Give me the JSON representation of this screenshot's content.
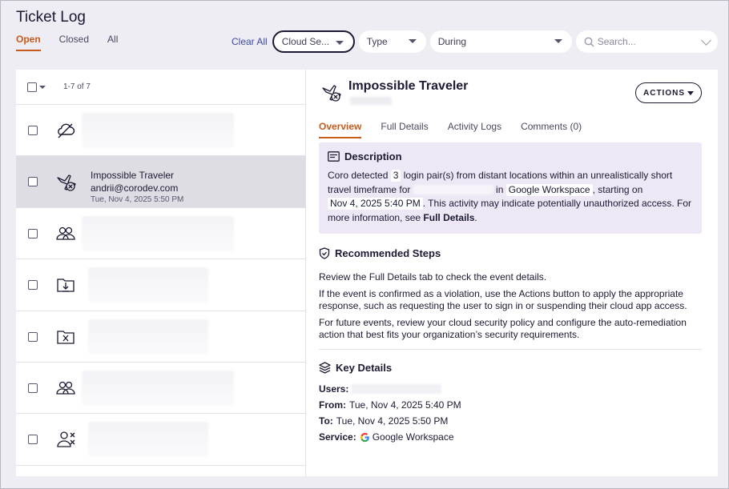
{
  "page_title": "Ticket Log",
  "tabs": [
    {
      "label": "Open",
      "active": true
    },
    {
      "label": "Closed",
      "active": false
    },
    {
      "label": "All",
      "active": false
    }
  ],
  "filters": {
    "clear_all": "Clear All",
    "cloud_service": "Cloud Se...",
    "type": "Type",
    "during": "During",
    "search_placeholder": "Search..."
  },
  "list": {
    "count_label": "1-7 of 7",
    "rows": [
      {
        "icon": "cloud-icon",
        "title": "",
        "subtitle": "",
        "date": "",
        "selected": false
      },
      {
        "icon": "impossible-traveler-icon",
        "title": "Impossible Traveler",
        "subtitle": "andrii@corodev.com",
        "date": "Tue, Nov 4, 2025 5:50 PM",
        "selected": true
      },
      {
        "icon": "users-icon",
        "title": "",
        "subtitle": "",
        "date": "",
        "selected": false
      },
      {
        "icon": "download-folder-icon",
        "title": "",
        "subtitle": "",
        "date": "",
        "selected": false
      },
      {
        "icon": "folder-x-icon",
        "title": "",
        "subtitle": "",
        "date": "",
        "selected": false
      },
      {
        "icon": "users-icon",
        "title": "",
        "subtitle": "",
        "date": "",
        "selected": false
      },
      {
        "icon": "user-x-icon",
        "title": "",
        "subtitle": "",
        "date": "",
        "selected": false
      }
    ]
  },
  "detail": {
    "title": "Impossible Traveler",
    "actions_label": "ACTIONS",
    "tabs": [
      {
        "label": "Overview",
        "active": true
      },
      {
        "label": "Full Details",
        "active": false
      },
      {
        "label": "Activity Logs",
        "active": false
      },
      {
        "label": "Comments (0)",
        "active": false
      }
    ],
    "description": {
      "heading": "Description",
      "t1": "Coro detected",
      "count": "3",
      "t2": "login pair(s) from distant locations within an unrealistically short travel timeframe for",
      "t3": "in",
      "service": "Google Workspace",
      "t4": ", starting on",
      "start": "Nov 4, 2025 5:40 PM",
      "t5": ". This activity may indicate potentially unauthorized access. For more information, see",
      "link": "Full Details",
      "t6": "."
    },
    "recommended": {
      "heading": "Recommended Steps",
      "steps": [
        "Review the Full Details tab to check the event details.",
        "If the event is confirmed as a violation, use the Actions button to apply the appropriate response, such as requesting the user to sign in or suspending their cloud app access.",
        "For future events, review your cloud security policy and configure the auto-remediation action that best fits your organization’s security requirements."
      ]
    },
    "key_details": {
      "heading": "Key Details",
      "users_label": "Users:",
      "from_label": "From:",
      "from_value": "Tue, Nov 4, 2025 5:40 PM",
      "to_label": "To:",
      "to_value": "Tue, Nov 4, 2025 5:50 PM",
      "service_label": "Service:",
      "service_value": "Google Workspace"
    }
  },
  "colors": {
    "accent": "#c85a1c",
    "link": "#3b49a4",
    "description_bg": "#ede7f6",
    "selected_row": "#dedde3"
  }
}
